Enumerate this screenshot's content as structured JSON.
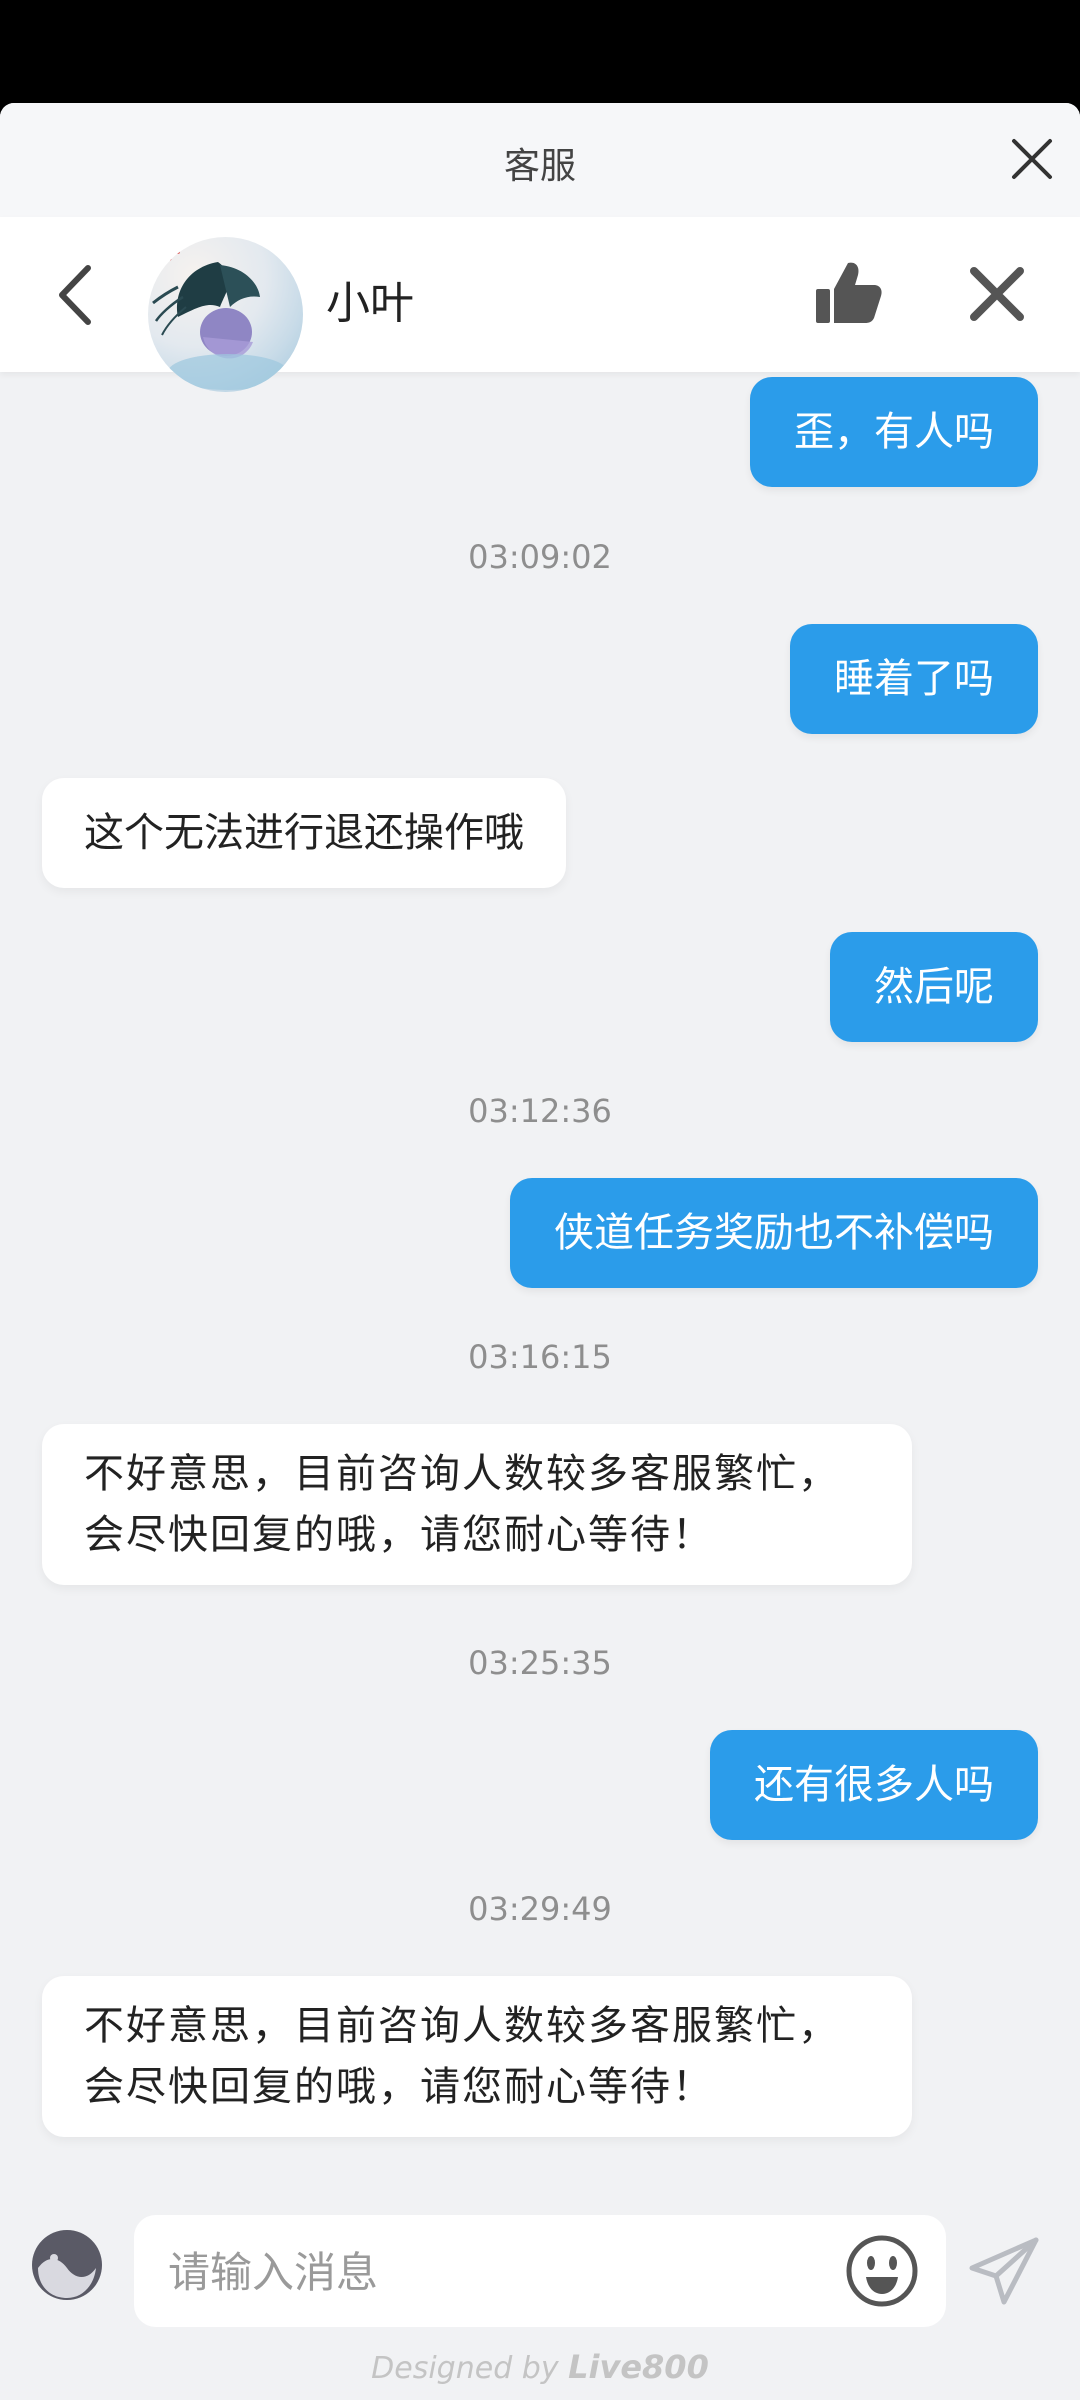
{
  "top_bar": {
    "title": "客服"
  },
  "header": {
    "agent_name": "小叶"
  },
  "messages": [
    {
      "text": "歪，有人吗"
    },
    {
      "text": "03:09:02"
    },
    {
      "text": "睡着了吗"
    },
    {
      "text": "这个无法进行退还操作哦"
    },
    {
      "text": "然后呢"
    },
    {
      "text": "03:12:36"
    },
    {
      "text": "侠道任务奖励也不补偿吗"
    },
    {
      "text": "03:16:15"
    },
    {
      "text": "不好意思，目前咨询人数较多客服繁忙，会尽快回复的哦，请您耐心等待！"
    },
    {
      "text": "03:25:35"
    },
    {
      "text": "还有很多人吗"
    },
    {
      "text": "03:29:49"
    },
    {
      "text": "不好意思，目前咨询人数较多客服繁忙，会尽快回复的哦，请您耐心等待！"
    }
  ],
  "composer": {
    "placeholder": "请输入消息"
  },
  "footer": {
    "prefix": "Designed by ",
    "brand": "Live800"
  },
  "colors": {
    "outgoing_bubble": "#2b9cea",
    "incoming_bubble": "#ffffff",
    "background": "#f1f2f4"
  },
  "icons": [
    "close-icon",
    "back-icon",
    "thumbs-up-icon",
    "end-chat-icon",
    "emoji-toggle-icon",
    "smiley-icon",
    "send-icon"
  ]
}
